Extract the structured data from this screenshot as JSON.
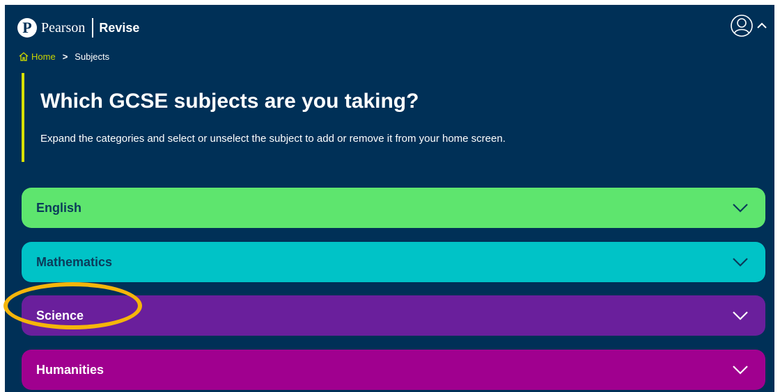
{
  "header": {
    "logo_letter": "P",
    "brand": "Pearson",
    "product": "Revise",
    "icons": {
      "logo": "pearson-logo-icon",
      "user": "user-account-icon",
      "menu": "chevron-up-icon"
    }
  },
  "breadcrumb": {
    "home_label": "Home",
    "separator": ">",
    "current": "Subjects",
    "icons": {
      "home": "home-icon"
    }
  },
  "hero": {
    "title": "Which GCSE subjects are you taking?",
    "description": "Expand the categories and select or unselect the subject to add or remove it from your home screen."
  },
  "categories": [
    {
      "label": "English",
      "color": "#5ee56e",
      "icon": "chevron-down-icon"
    },
    {
      "label": "Mathematics",
      "color": "#00c3c7",
      "icon": "chevron-down-icon"
    },
    {
      "label": "Science",
      "color": "#6a1f9c",
      "icon": "chevron-down-icon",
      "highlighted": true
    },
    {
      "label": "Humanities",
      "color": "#a0008f",
      "icon": "chevron-down-icon"
    }
  ],
  "colors": {
    "background": "#003057",
    "accent": "#d8e100",
    "highlight_ring": "#f5b50a"
  }
}
